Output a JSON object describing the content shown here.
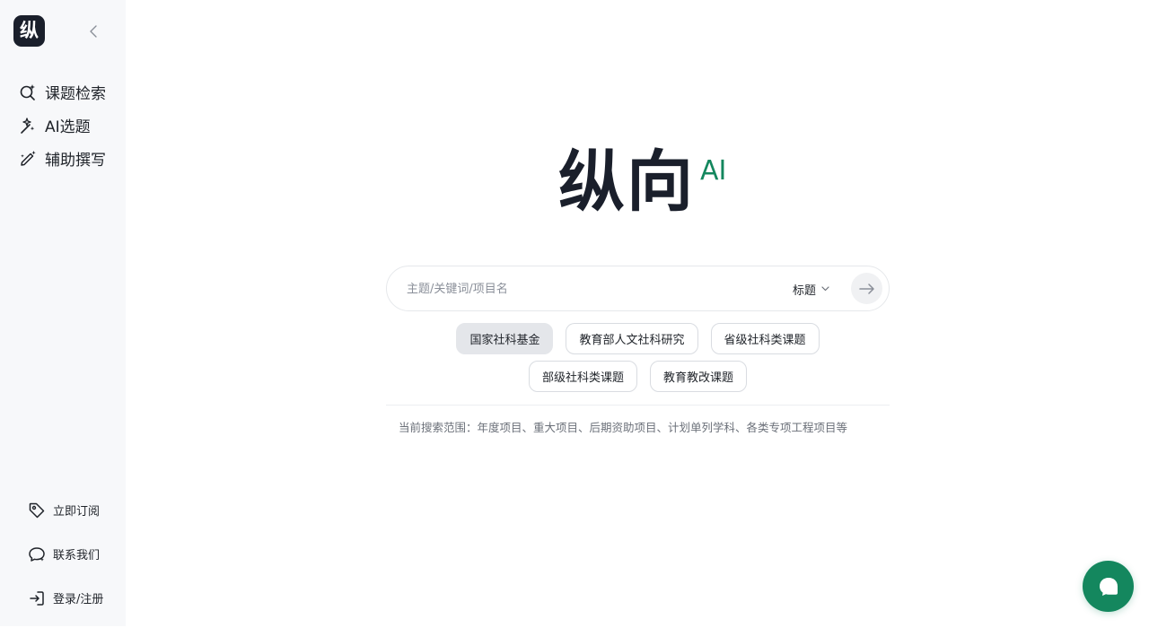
{
  "sidebar": {
    "logo_char": "纵",
    "items": [
      {
        "label": "课题检索",
        "icon": "search-sparkle-icon"
      },
      {
        "label": "AI选题",
        "icon": "magic-wand-icon"
      },
      {
        "label": "辅助撰写",
        "icon": "pen-sparkle-icon"
      }
    ],
    "bottom": [
      {
        "label": "立即订阅",
        "icon": "tag-icon"
      },
      {
        "label": "联系我们",
        "icon": "chat-bubble-icon"
      },
      {
        "label": "登录/注册",
        "icon": "login-icon"
      }
    ]
  },
  "brand": {
    "name": "纵向",
    "suffix": "AI"
  },
  "search": {
    "placeholder": "主题/关键词/项目名",
    "value": "",
    "field": "标题"
  },
  "categories": {
    "row1": [
      "国家社科基金",
      "教育部人文社科研究",
      "省级社科类课题"
    ],
    "row2": [
      "部级社科类课题",
      "教育教改课题"
    ],
    "active": "国家社科基金"
  },
  "scope_text": "当前搜索范围：年度项目、重大项目、后期资助项目、计划单列学科、各类专项工程项目等",
  "colors": {
    "accent": "#14875e",
    "logo_bg": "#1a1f2b",
    "sidebar_bg": "#f7f8fa"
  }
}
